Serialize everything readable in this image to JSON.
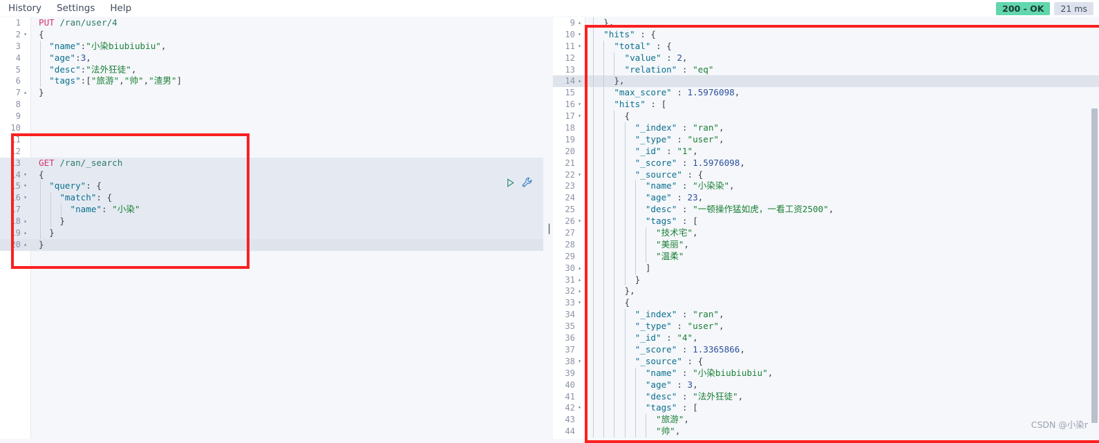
{
  "menu": {
    "items": [
      {
        "label": "History",
        "name": "menu-history"
      },
      {
        "label": "Settings",
        "name": "menu-settings"
      },
      {
        "label": "Help",
        "name": "menu-help"
      }
    ]
  },
  "status": {
    "code_label": "200 - OK",
    "time_label": "21 ms",
    "ok_color": "#62d6ad",
    "time_color": "#dde2ec"
  },
  "icons": {
    "play": "play-icon",
    "wrench": "wrench-icon",
    "resize_handle": "||"
  },
  "annotations": {
    "box_color": "#fb2020",
    "left_box_label": "red-highlight-query",
    "right_box_label": "red-highlight-response"
  },
  "watermark": "CSDN @小染r",
  "request_editor": {
    "name": "request-editor",
    "lines": [
      {
        "n": "1",
        "fold": "",
        "text": "PUT /ran/user/4",
        "seg": [
          [
            "m",
            "PUT"
          ],
          [
            "p",
            " "
          ],
          [
            "u",
            "/ran/user/4"
          ]
        ]
      },
      {
        "n": "2",
        "fold": "▾",
        "seg": [
          [
            "p",
            "{"
          ]
        ]
      },
      {
        "n": "3",
        "fold": "",
        "seg": [
          [
            "p",
            "  "
          ],
          [
            "k",
            "\"name\""
          ],
          [
            "p",
            ":"
          ],
          [
            "s",
            "\"小染biubiubiu\""
          ],
          [
            "p",
            ","
          ]
        ]
      },
      {
        "n": "4",
        "fold": "",
        "seg": [
          [
            "p",
            "  "
          ],
          [
            "k",
            "\"age\""
          ],
          [
            "p",
            ":"
          ],
          [
            "n",
            "3"
          ],
          [
            "p",
            ","
          ]
        ]
      },
      {
        "n": "5",
        "fold": "",
        "seg": [
          [
            "p",
            "  "
          ],
          [
            "k",
            "\"desc\""
          ],
          [
            "p",
            ":"
          ],
          [
            "s",
            "\"法外狂徒\""
          ],
          [
            "p",
            ","
          ]
        ]
      },
      {
        "n": "6",
        "fold": "",
        "seg": [
          [
            "p",
            "  "
          ],
          [
            "k",
            "\"tags\""
          ],
          [
            "p",
            ":["
          ],
          [
            "s",
            "\"旅游\""
          ],
          [
            "p",
            ","
          ],
          [
            "s",
            "\"帅\""
          ],
          [
            "p",
            ","
          ],
          [
            "s",
            "\"渣男\""
          ],
          [
            "p",
            "]"
          ]
        ]
      },
      {
        "n": "7",
        "fold": "▴",
        "seg": [
          [
            "p",
            "}"
          ]
        ]
      },
      {
        "n": "8",
        "fold": "",
        "seg": []
      },
      {
        "n": "9",
        "fold": "",
        "seg": []
      },
      {
        "n": "10",
        "fold": "",
        "seg": []
      },
      {
        "n": "11",
        "fold": "",
        "seg": []
      },
      {
        "n": "12",
        "fold": "",
        "seg": []
      },
      {
        "n": "13",
        "fold": "",
        "sel": true,
        "seg": [
          [
            "m",
            "GET"
          ],
          [
            "p",
            " "
          ],
          [
            "u",
            "/ran/_search"
          ]
        ]
      },
      {
        "n": "14",
        "fold": "▾",
        "sel": true,
        "seg": [
          [
            "p",
            "{"
          ]
        ]
      },
      {
        "n": "15",
        "fold": "▾",
        "sel": true,
        "seg": [
          [
            "p",
            "  "
          ],
          [
            "k",
            "\"query\""
          ],
          [
            "p",
            ": {"
          ]
        ]
      },
      {
        "n": "16",
        "fold": "▾",
        "sel": true,
        "seg": [
          [
            "p",
            "    "
          ],
          [
            "k",
            "\"match\""
          ],
          [
            "p",
            ": {"
          ]
        ]
      },
      {
        "n": "17",
        "fold": "",
        "sel": true,
        "seg": [
          [
            "p",
            "      "
          ],
          [
            "k",
            "\"name\""
          ],
          [
            "p",
            ": "
          ],
          [
            "s",
            "\"小染\""
          ]
        ]
      },
      {
        "n": "18",
        "fold": "▴",
        "sel": true,
        "seg": [
          [
            "p",
            "    }"
          ]
        ]
      },
      {
        "n": "19",
        "fold": "▴",
        "sel": true,
        "seg": [
          [
            "p",
            "  }"
          ]
        ]
      },
      {
        "n": "20",
        "fold": "▴",
        "active": true,
        "seg": [
          [
            "p",
            "}"
          ]
        ]
      }
    ]
  },
  "response_editor": {
    "name": "response-editor",
    "lines": [
      {
        "n": "9",
        "fold": "▴",
        "seg": [
          [
            "p",
            "  },"
          ]
        ]
      },
      {
        "n": "10",
        "fold": "▾",
        "seg": [
          [
            "p",
            "  "
          ],
          [
            "k",
            "\"hits\""
          ],
          [
            "p",
            " : {"
          ]
        ]
      },
      {
        "n": "11",
        "fold": "▾",
        "seg": [
          [
            "p",
            "    "
          ],
          [
            "k",
            "\"total\""
          ],
          [
            "p",
            " : {"
          ]
        ]
      },
      {
        "n": "12",
        "fold": "",
        "seg": [
          [
            "p",
            "      "
          ],
          [
            "k",
            "\"value\""
          ],
          [
            "p",
            " : "
          ],
          [
            "n",
            "2"
          ],
          [
            "p",
            ","
          ]
        ]
      },
      {
        "n": "13",
        "fold": "",
        "seg": [
          [
            "p",
            "      "
          ],
          [
            "k",
            "\"relation\""
          ],
          [
            "p",
            " : "
          ],
          [
            "s",
            "\"eq\""
          ]
        ]
      },
      {
        "n": "14",
        "fold": "▴",
        "active": true,
        "seg": [
          [
            "p",
            "    },"
          ]
        ]
      },
      {
        "n": "15",
        "fold": "",
        "seg": [
          [
            "p",
            "    "
          ],
          [
            "k",
            "\"max_score\""
          ],
          [
            "p",
            " : "
          ],
          [
            "n",
            "1.5976098"
          ],
          [
            "p",
            ","
          ]
        ]
      },
      {
        "n": "16",
        "fold": "▾",
        "seg": [
          [
            "p",
            "    "
          ],
          [
            "k",
            "\"hits\""
          ],
          [
            "p",
            " : ["
          ]
        ]
      },
      {
        "n": "17",
        "fold": "▾",
        "seg": [
          [
            "p",
            "      {"
          ]
        ]
      },
      {
        "n": "18",
        "fold": "",
        "seg": [
          [
            "p",
            "        "
          ],
          [
            "k",
            "\"_index\""
          ],
          [
            "p",
            " : "
          ],
          [
            "s",
            "\"ran\""
          ],
          [
            "p",
            ","
          ]
        ]
      },
      {
        "n": "19",
        "fold": "",
        "seg": [
          [
            "p",
            "        "
          ],
          [
            "k",
            "\"_type\""
          ],
          [
            "p",
            " : "
          ],
          [
            "s",
            "\"user\""
          ],
          [
            "p",
            ","
          ]
        ]
      },
      {
        "n": "20",
        "fold": "",
        "seg": [
          [
            "p",
            "        "
          ],
          [
            "k",
            "\"_id\""
          ],
          [
            "p",
            " : "
          ],
          [
            "s",
            "\"1\""
          ],
          [
            "p",
            ","
          ]
        ]
      },
      {
        "n": "21",
        "fold": "",
        "seg": [
          [
            "p",
            "        "
          ],
          [
            "k",
            "\"_score\""
          ],
          [
            "p",
            " : "
          ],
          [
            "n",
            "1.5976098"
          ],
          [
            "p",
            ","
          ]
        ]
      },
      {
        "n": "22",
        "fold": "▾",
        "seg": [
          [
            "p",
            "        "
          ],
          [
            "k",
            "\"_source\""
          ],
          [
            "p",
            " : {"
          ]
        ]
      },
      {
        "n": "23",
        "fold": "",
        "seg": [
          [
            "p",
            "          "
          ],
          [
            "k",
            "\"name\""
          ],
          [
            "p",
            " : "
          ],
          [
            "s",
            "\"小染染\""
          ],
          [
            "p",
            ","
          ]
        ]
      },
      {
        "n": "24",
        "fold": "",
        "seg": [
          [
            "p",
            "          "
          ],
          [
            "k",
            "\"age\""
          ],
          [
            "p",
            " : "
          ],
          [
            "n",
            "23"
          ],
          [
            "p",
            ","
          ]
        ]
      },
      {
        "n": "25",
        "fold": "",
        "seg": [
          [
            "p",
            "          "
          ],
          [
            "k",
            "\"desc\""
          ],
          [
            "p",
            " : "
          ],
          [
            "s",
            "\"一顿操作猛如虎，一看工资2500\""
          ],
          [
            "p",
            ","
          ]
        ]
      },
      {
        "n": "26",
        "fold": "▾",
        "seg": [
          [
            "p",
            "          "
          ],
          [
            "k",
            "\"tags\""
          ],
          [
            "p",
            " : ["
          ]
        ]
      },
      {
        "n": "27",
        "fold": "",
        "seg": [
          [
            "p",
            "            "
          ],
          [
            "s",
            "\"技术宅\""
          ],
          [
            "p",
            ","
          ]
        ]
      },
      {
        "n": "28",
        "fold": "",
        "seg": [
          [
            "p",
            "            "
          ],
          [
            "s",
            "\"美丽\""
          ],
          [
            "p",
            ","
          ]
        ]
      },
      {
        "n": "29",
        "fold": "",
        "seg": [
          [
            "p",
            "            "
          ],
          [
            "s",
            "\"温柔\""
          ]
        ]
      },
      {
        "n": "30",
        "fold": "▴",
        "seg": [
          [
            "p",
            "          ]"
          ]
        ]
      },
      {
        "n": "31",
        "fold": "▴",
        "seg": [
          [
            "p",
            "        }"
          ]
        ]
      },
      {
        "n": "32",
        "fold": "▴",
        "seg": [
          [
            "p",
            "      },"
          ]
        ]
      },
      {
        "n": "33",
        "fold": "▾",
        "seg": [
          [
            "p",
            "      {"
          ]
        ]
      },
      {
        "n": "34",
        "fold": "",
        "seg": [
          [
            "p",
            "        "
          ],
          [
            "k",
            "\"_index\""
          ],
          [
            "p",
            " : "
          ],
          [
            "s",
            "\"ran\""
          ],
          [
            "p",
            ","
          ]
        ]
      },
      {
        "n": "35",
        "fold": "",
        "seg": [
          [
            "p",
            "        "
          ],
          [
            "k",
            "\"_type\""
          ],
          [
            "p",
            " : "
          ],
          [
            "s",
            "\"user\""
          ],
          [
            "p",
            ","
          ]
        ]
      },
      {
        "n": "36",
        "fold": "",
        "seg": [
          [
            "p",
            "        "
          ],
          [
            "k",
            "\"_id\""
          ],
          [
            "p",
            " : "
          ],
          [
            "s",
            "\"4\""
          ],
          [
            "p",
            ","
          ]
        ]
      },
      {
        "n": "37",
        "fold": "",
        "seg": [
          [
            "p",
            "        "
          ],
          [
            "k",
            "\"_score\""
          ],
          [
            "p",
            " : "
          ],
          [
            "n",
            "1.3365866"
          ],
          [
            "p",
            ","
          ]
        ]
      },
      {
        "n": "38",
        "fold": "▾",
        "seg": [
          [
            "p",
            "        "
          ],
          [
            "k",
            "\"_source\""
          ],
          [
            "p",
            " : {"
          ]
        ]
      },
      {
        "n": "39",
        "fold": "",
        "seg": [
          [
            "p",
            "          "
          ],
          [
            "k",
            "\"name\""
          ],
          [
            "p",
            " : "
          ],
          [
            "s",
            "\"小染biubiubiu\""
          ],
          [
            "p",
            ","
          ]
        ]
      },
      {
        "n": "40",
        "fold": "",
        "seg": [
          [
            "p",
            "          "
          ],
          [
            "k",
            "\"age\""
          ],
          [
            "p",
            " : "
          ],
          [
            "n",
            "3"
          ],
          [
            "p",
            ","
          ]
        ]
      },
      {
        "n": "41",
        "fold": "",
        "seg": [
          [
            "p",
            "          "
          ],
          [
            "k",
            "\"desc\""
          ],
          [
            "p",
            " : "
          ],
          [
            "s",
            "\"法外狂徒\""
          ],
          [
            "p",
            ","
          ]
        ]
      },
      {
        "n": "42",
        "fold": "▾",
        "seg": [
          [
            "p",
            "          "
          ],
          [
            "k",
            "\"tags\""
          ],
          [
            "p",
            " : ["
          ]
        ]
      },
      {
        "n": "43",
        "fold": "",
        "seg": [
          [
            "p",
            "            "
          ],
          [
            "s",
            "\"旅游\""
          ],
          [
            "p",
            ","
          ]
        ]
      },
      {
        "n": "44",
        "fold": "",
        "seg": [
          [
            "p",
            "            "
          ],
          [
            "s",
            "\"帅\""
          ],
          [
            "p",
            ","
          ]
        ]
      }
    ]
  }
}
